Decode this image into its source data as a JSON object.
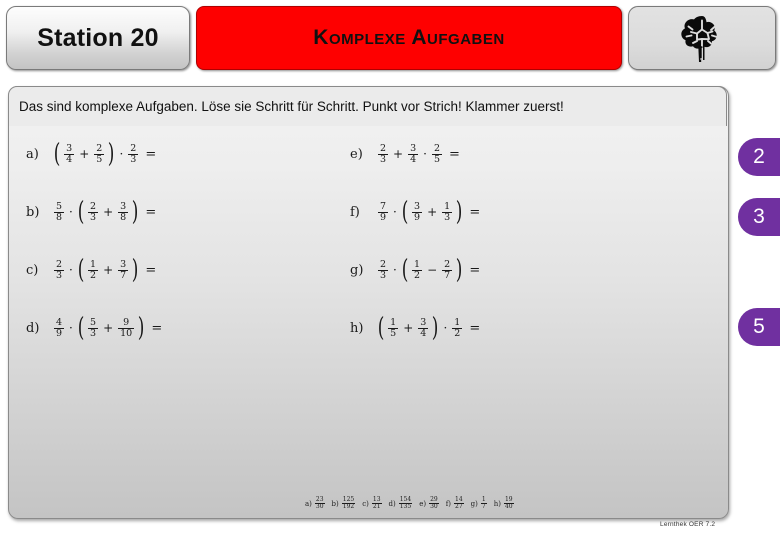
{
  "header": {
    "station_label": "Station 20",
    "title": "Komplexe Aufgaben",
    "brain_icon": "brain-icon"
  },
  "instruction": {
    "text": "Das sind komplexe Aufgaben. Löse sie Schritt für Schritt. Punkt vor Strich! Klammer zuerst!"
  },
  "exercises": {
    "left": [
      {
        "label": "a)",
        "parts": [
          {
            "t": "paren",
            "v": "("
          },
          {
            "t": "frac",
            "n": "3",
            "d": "4"
          },
          {
            "t": "op",
            "v": "+"
          },
          {
            "t": "frac",
            "n": "2",
            "d": "5"
          },
          {
            "t": "paren",
            "v": ")"
          },
          {
            "t": "dot",
            "v": "·"
          },
          {
            "t": "frac",
            "n": "2",
            "d": "3"
          },
          {
            "t": "eq",
            "v": "="
          }
        ]
      },
      {
        "label": "b)",
        "parts": [
          {
            "t": "frac",
            "n": "5",
            "d": "8"
          },
          {
            "t": "dot",
            "v": "·"
          },
          {
            "t": "paren",
            "v": "("
          },
          {
            "t": "frac",
            "n": "2",
            "d": "3"
          },
          {
            "t": "op",
            "v": "+"
          },
          {
            "t": "frac",
            "n": "3",
            "d": "8"
          },
          {
            "t": "paren",
            "v": ")"
          },
          {
            "t": "eq",
            "v": "="
          }
        ]
      },
      {
        "label": "c)",
        "parts": [
          {
            "t": "frac",
            "n": "2",
            "d": "3"
          },
          {
            "t": "dot",
            "v": "·"
          },
          {
            "t": "paren",
            "v": "("
          },
          {
            "t": "frac",
            "n": "1",
            "d": "2"
          },
          {
            "t": "op",
            "v": "+"
          },
          {
            "t": "frac",
            "n": "3",
            "d": "7"
          },
          {
            "t": "paren",
            "v": ")"
          },
          {
            "t": "eq",
            "v": "="
          }
        ]
      },
      {
        "label": "d)",
        "parts": [
          {
            "t": "frac",
            "n": "4",
            "d": "9"
          },
          {
            "t": "dot",
            "v": "·"
          },
          {
            "t": "paren",
            "v": "("
          },
          {
            "t": "frac",
            "n": "5",
            "d": "3"
          },
          {
            "t": "op",
            "v": "+"
          },
          {
            "t": "frac",
            "n": "9",
            "d": "10"
          },
          {
            "t": "paren",
            "v": ")"
          },
          {
            "t": "eq",
            "v": "="
          }
        ]
      }
    ],
    "right": [
      {
        "label": "e)",
        "parts": [
          {
            "t": "frac",
            "n": "2",
            "d": "3"
          },
          {
            "t": "op",
            "v": "+"
          },
          {
            "t": "frac",
            "n": "3",
            "d": "4"
          },
          {
            "t": "dot",
            "v": "·"
          },
          {
            "t": "frac",
            "n": "2",
            "d": "5"
          },
          {
            "t": "eq",
            "v": "="
          }
        ]
      },
      {
        "label": "f)",
        "parts": [
          {
            "t": "frac",
            "n": "7",
            "d": "9"
          },
          {
            "t": "dot",
            "v": "·"
          },
          {
            "t": "paren",
            "v": "("
          },
          {
            "t": "frac",
            "n": "3",
            "d": "9"
          },
          {
            "t": "op",
            "v": "+"
          },
          {
            "t": "frac",
            "n": "1",
            "d": "3"
          },
          {
            "t": "paren",
            "v": ")"
          },
          {
            "t": "eq",
            "v": "="
          }
        ]
      },
      {
        "label": "g)",
        "parts": [
          {
            "t": "frac",
            "n": "2",
            "d": "3"
          },
          {
            "t": "dot",
            "v": "·"
          },
          {
            "t": "paren",
            "v": "("
          },
          {
            "t": "frac",
            "n": "1",
            "d": "2"
          },
          {
            "t": "op",
            "v": "−"
          },
          {
            "t": "frac",
            "n": "2",
            "d": "7"
          },
          {
            "t": "paren",
            "v": ")"
          },
          {
            "t": "eq",
            "v": "="
          }
        ]
      },
      {
        "label": "h)",
        "parts": [
          {
            "t": "paren",
            "v": "("
          },
          {
            "t": "frac",
            "n": "1",
            "d": "5"
          },
          {
            "t": "op",
            "v": "+"
          },
          {
            "t": "frac",
            "n": "3",
            "d": "4"
          },
          {
            "t": "paren",
            "v": ")"
          },
          {
            "t": "dot",
            "v": "·"
          },
          {
            "t": "frac",
            "n": "1",
            "d": "2"
          },
          {
            "t": "eq",
            "v": "="
          }
        ]
      }
    ]
  },
  "badges": [
    {
      "value": "2"
    },
    {
      "value": "3"
    },
    {
      "value": "5"
    }
  ],
  "answer_key": [
    {
      "label": "a)",
      "num": "23",
      "den": "30"
    },
    {
      "label": "b)",
      "num": "125",
      "den": "192"
    },
    {
      "label": "c)",
      "num": "13",
      "den": "21"
    },
    {
      "label": "d)",
      "num": "154",
      "den": "135"
    },
    {
      "label": "e)",
      "num": "29",
      "den": "30"
    },
    {
      "label": "f)",
      "num": "14",
      "den": "27"
    },
    {
      "label": "g)",
      "num": "1",
      "den": "7"
    },
    {
      "label": "h)",
      "num": "19",
      "den": "40"
    }
  ],
  "footer": {
    "text": "Lernthek OER 7.2"
  },
  "colors": {
    "title_bg": "#fe0000",
    "badge_bg": "#7030a0",
    "panel_bg": "#e3e3e3"
  }
}
